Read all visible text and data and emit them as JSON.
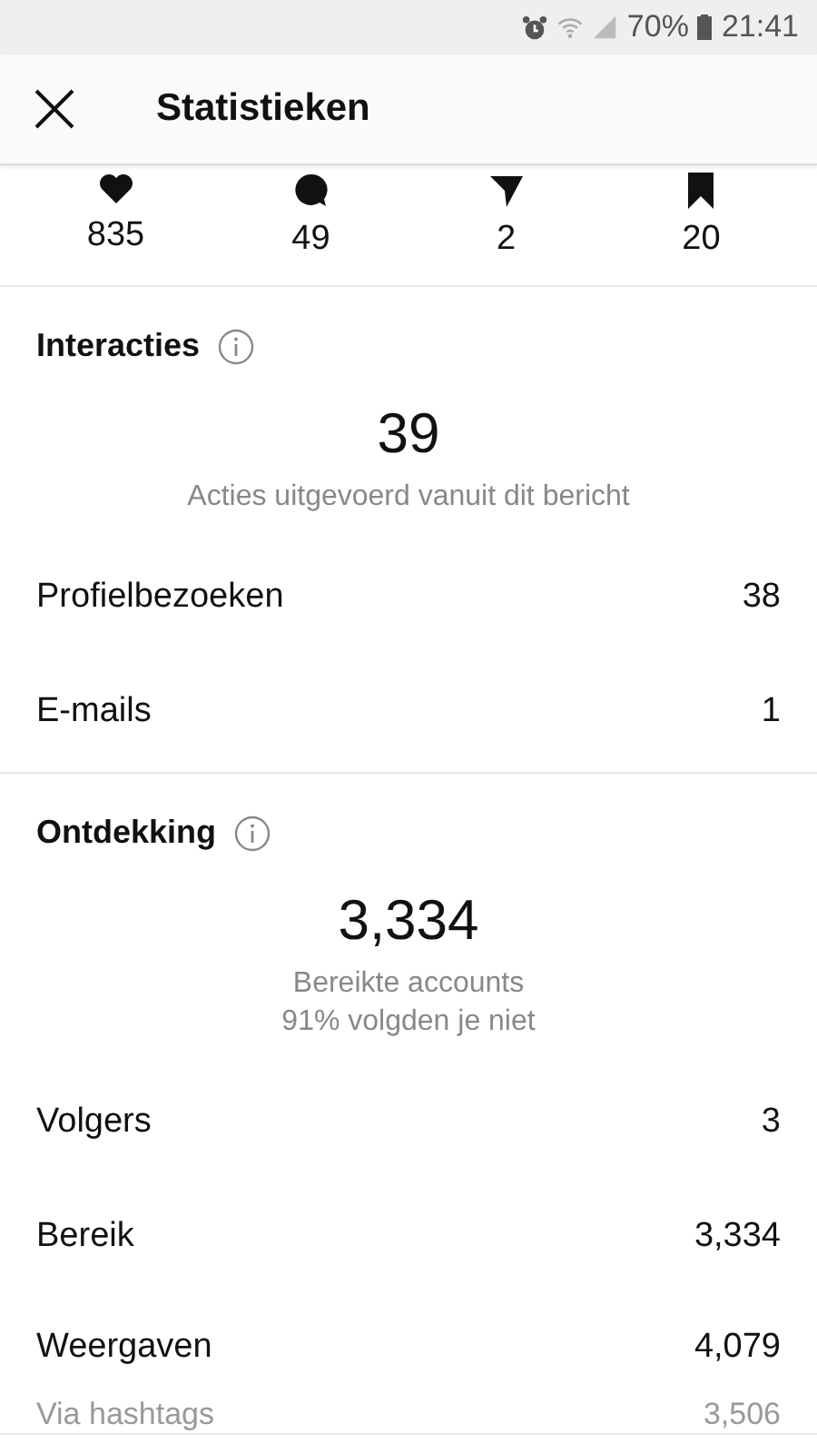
{
  "status_bar": {
    "battery": "70%",
    "time": "21:41"
  },
  "header": {
    "title": "Statistieken"
  },
  "counts": [
    {
      "kind": "like",
      "value": "835"
    },
    {
      "kind": "comment",
      "value": "49"
    },
    {
      "kind": "share",
      "value": "2"
    },
    {
      "kind": "save",
      "value": "20"
    }
  ],
  "sections": [
    {
      "title": "Interacties",
      "total": "39",
      "captions": [
        "Acties uitgevoerd vanuit dit bericht"
      ],
      "rows": [
        {
          "kind": "main",
          "label": "Profielbezoeken",
          "value": "38"
        },
        {
          "kind": "main",
          "label": "E-mails",
          "value": "1"
        }
      ]
    },
    {
      "title": "Ontdekking",
      "total": "3,334",
      "captions": [
        "Bereikte accounts",
        "91% volgden je niet"
      ],
      "rows": [
        {
          "kind": "main",
          "label": "Volgers",
          "value": "3"
        },
        {
          "kind": "main",
          "label": "Bereik",
          "value": "3,334"
        },
        {
          "kind": "main",
          "label": "Weergaven",
          "value": "4,079"
        },
        {
          "kind": "sub",
          "label": "Via hashtags",
          "value": "3,506"
        }
      ]
    }
  ]
}
